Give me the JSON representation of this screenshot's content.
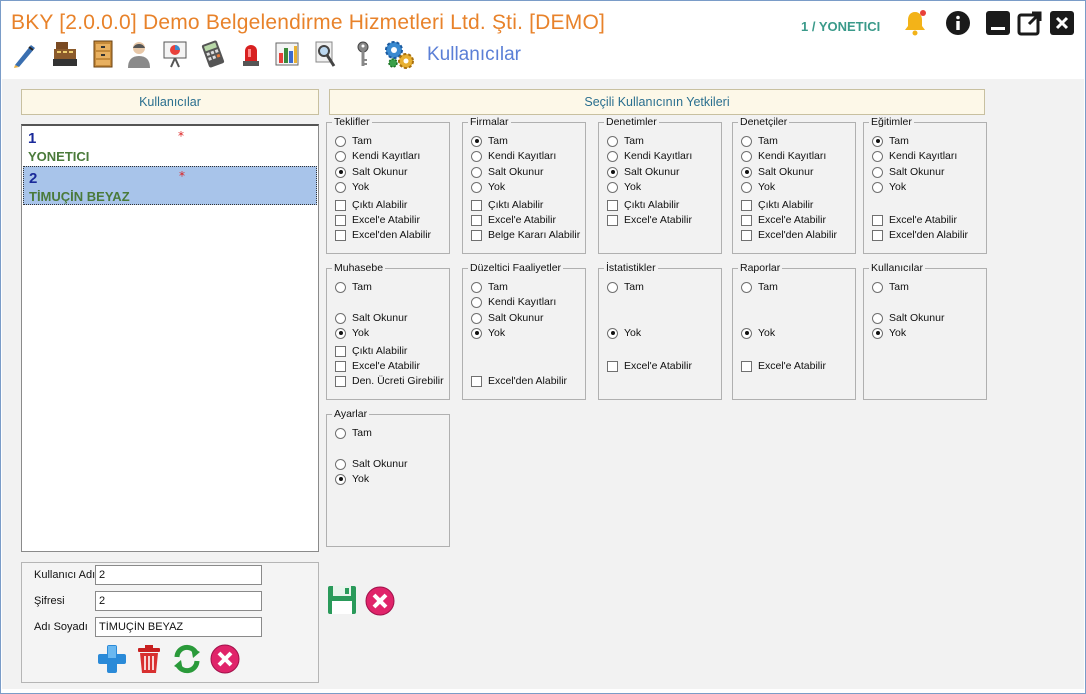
{
  "app": {
    "title": "BKY [2.0.0.0] Demo Belgelendirme Hizmetleri Ltd. Şti. [DEMO]",
    "user": "1 / YONETICI",
    "section": "Kullanıcılar"
  },
  "left": {
    "header": "Kullanıcılar",
    "users": [
      {
        "num": "1",
        "name": "YONETICI",
        "mark": "*",
        "selected": false
      },
      {
        "num": "2",
        "name": "TİMUÇİN BEYAZ",
        "mark": "*",
        "selected": true
      }
    ],
    "form": {
      "username_label": "Kullanıcı Adı",
      "username": "2",
      "password_label": "Şifresi",
      "password": "2",
      "fullname_label": "Adı Soyadı",
      "fullname": "TİMUÇİN BEYAZ"
    }
  },
  "right": {
    "header": "Seçili Kullanıcının Yetkileri",
    "groups": {
      "teklifler": {
        "title": "Teklifler",
        "radios": [
          "Tam",
          "Kendi Kayıtları",
          "Salt Okunur",
          "Yok"
        ],
        "selected": "Salt Okunur",
        "checks": [
          "Çıktı Alabilir",
          "Excel'e Atabilir",
          "Excel'den Alabilir"
        ]
      },
      "firmalar": {
        "title": "Firmalar",
        "radios": [
          "Tam",
          "Kendi Kayıtları",
          "Salt Okunur",
          "Yok"
        ],
        "selected": "Tam",
        "checks": [
          "Çıktı Alabilir",
          "Excel'e Atabilir",
          "Belge Kararı Alabilir"
        ]
      },
      "denetimler": {
        "title": "Denetimler",
        "radios": [
          "Tam",
          "Kendi Kayıtları",
          "Salt Okunur",
          "Yok"
        ],
        "selected": "Salt Okunur",
        "checks": [
          "Çıktı Alabilir",
          "Excel'e Atabilir"
        ]
      },
      "denetciler": {
        "title": "Denetçiler",
        "radios": [
          "Tam",
          "Kendi Kayıtları",
          "Salt Okunur",
          "Yok"
        ],
        "selected": "Salt Okunur",
        "checks": [
          "Çıktı Alabilir",
          "Excel'e Atabilir",
          "Excel'den Alabilir"
        ]
      },
      "egitimler": {
        "title": "Eğitimler",
        "radios": [
          "Tam",
          "Kendi Kayıtları",
          "Salt Okunur",
          "Yok"
        ],
        "selected": "Tam",
        "checks": [
          "Excel'e Atabilir",
          "Excel'den Alabilir"
        ]
      },
      "muhasebe": {
        "title": "Muhasebe",
        "radios": [
          "Tam",
          "Salt Okunur",
          "Yok"
        ],
        "selected": "Yok",
        "checks": [
          "Çıktı Alabilir",
          "Excel'e Atabilir",
          "Den. Ücreti Girebilir"
        ]
      },
      "duzeltici": {
        "title": "Düzeltici Faaliyetler",
        "radios": [
          "Tam",
          "Kendi Kayıtları",
          "Salt Okunur",
          "Yok"
        ],
        "selected": "Yok",
        "checks": [
          "Excel'den Alabilir"
        ]
      },
      "istatistikler": {
        "title": "İstatistikler",
        "radios": [
          "Tam",
          "Yok"
        ],
        "selected": "Yok",
        "checks": [
          "Excel'e Atabilir"
        ]
      },
      "raporlar": {
        "title": "Raporlar",
        "radios": [
          "Tam",
          "Yok"
        ],
        "selected": "Yok",
        "checks": [
          "Excel'e Atabilir"
        ]
      },
      "kullanicilar": {
        "title": "Kullanıcılar",
        "radios": [
          "Tam",
          "Salt Okunur",
          "Yok"
        ],
        "selected": "Yok",
        "checks": []
      },
      "ayarlar": {
        "title": "Ayarlar",
        "radios": [
          "Tam",
          "Salt Okunur",
          "Yok"
        ],
        "selected": "Yok",
        "checks": []
      }
    }
  },
  "icons": {
    "toolbar": [
      "pen-icon",
      "cash-register-icon",
      "cabinet-icon",
      "user-icon",
      "presentation-icon",
      "calculator-icon",
      "alarm-light-icon",
      "chart-icon",
      "magnifier-icon",
      "key-icon",
      "gears-icon"
    ],
    "window": [
      "bell-icon",
      "info-icon",
      "minimize-icon",
      "popout-icon",
      "close-icon"
    ]
  },
  "colors": {
    "title": "#e8822a",
    "accent": "#5b7fd6",
    "user": "#3a9a8a",
    "selection": "#a8c4ea",
    "header_bg": "#fdf8e8"
  }
}
